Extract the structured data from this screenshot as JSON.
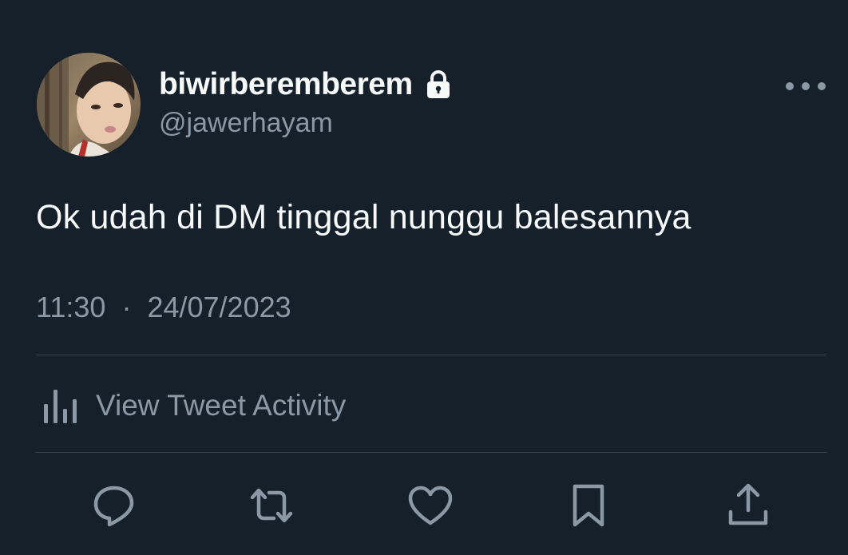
{
  "author": {
    "display_name": "biwirberemberem",
    "handle": "@jawerhayam",
    "protected_icon": "lock-icon",
    "avatar_alt": "profile-photo"
  },
  "tweet": {
    "text": "Ok udah di DM tinggal nunggu balesannya",
    "time": "11:30",
    "separator": "·",
    "date": "24/07/2023"
  },
  "activity": {
    "icon": "bar-chart-icon",
    "label": "View Tweet Activity"
  },
  "menu": {
    "icon": "more-horizontal-icon"
  },
  "actions": [
    {
      "name": "reply",
      "icon": "reply-icon"
    },
    {
      "name": "retweet",
      "icon": "retweet-icon"
    },
    {
      "name": "like",
      "icon": "heart-icon"
    },
    {
      "name": "bookmark",
      "icon": "bookmark-icon"
    },
    {
      "name": "share",
      "icon": "share-icon"
    }
  ],
  "colors": {
    "background": "#15202b",
    "primary_text": "#f7f9f9",
    "secondary_text": "#8b98a5",
    "divider": "#38444d"
  }
}
